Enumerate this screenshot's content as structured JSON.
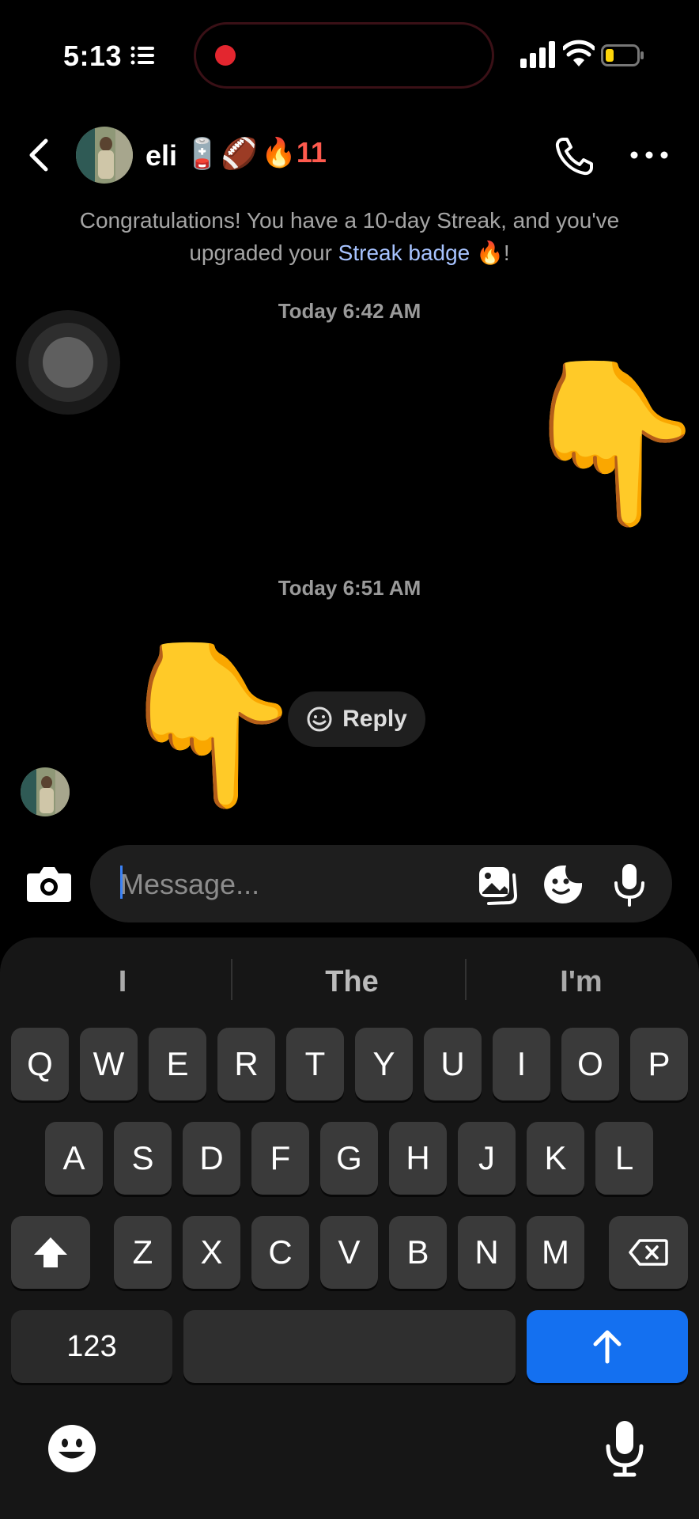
{
  "status_bar": {
    "time": "5:13"
  },
  "header": {
    "contact_name": "eli",
    "name_emoji": "🪫🏈",
    "streak": "🔥11"
  },
  "notice": {
    "prefix": "Congratulations! You have a 10-day Streak, and you've upgraded your ",
    "link": "Streak badge",
    "suffix": " 🔥!"
  },
  "messages": [
    {
      "timestamp": "Today 6:42 AM",
      "content": "👇"
    },
    {
      "timestamp": "Today 6:51 AM",
      "content": "👇"
    }
  ],
  "reply_button": {
    "label": "Reply"
  },
  "composer": {
    "placeholder": "Message..."
  },
  "keyboard": {
    "suggestions": [
      "I",
      "The",
      "I'm"
    ],
    "row1": [
      "Q",
      "W",
      "E",
      "R",
      "T",
      "Y",
      "U",
      "I",
      "O",
      "P"
    ],
    "row2": [
      "A",
      "S",
      "D",
      "F",
      "G",
      "H",
      "J",
      "K",
      "L"
    ],
    "row3": [
      "Z",
      "X",
      "C",
      "V",
      "B",
      "N",
      "M"
    ],
    "numbers_label": "123"
  },
  "colors": {
    "background": "#000000",
    "streak": "#ff5a4e",
    "link": "#a7c3ff",
    "send_key": "#1470f0",
    "recording": "#e3262f"
  }
}
